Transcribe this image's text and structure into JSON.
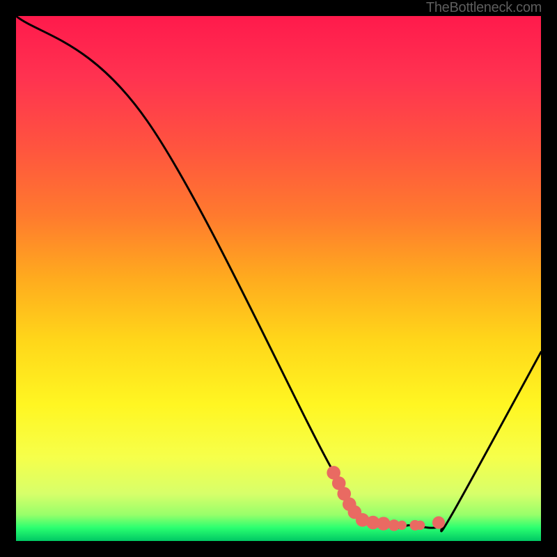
{
  "watermark": "TheBottleneck.com",
  "colors": {
    "frame_bg": "#000000",
    "watermark": "#5d5d5d",
    "curve_stroke": "#000000",
    "marker_fill": "#e96a62",
    "gradient_stops": [
      {
        "offset": 0.0,
        "color": "#ff1a4c"
      },
      {
        "offset": 0.12,
        "color": "#ff3350"
      },
      {
        "offset": 0.25,
        "color": "#ff543f"
      },
      {
        "offset": 0.38,
        "color": "#ff7a2e"
      },
      {
        "offset": 0.5,
        "color": "#ffab1e"
      },
      {
        "offset": 0.62,
        "color": "#ffd71a"
      },
      {
        "offset": 0.74,
        "color": "#fff622"
      },
      {
        "offset": 0.84,
        "color": "#f6ff4a"
      },
      {
        "offset": 0.91,
        "color": "#d7ff6a"
      },
      {
        "offset": 0.95,
        "color": "#98ff6a"
      },
      {
        "offset": 0.975,
        "color": "#2aff70"
      },
      {
        "offset": 1.0,
        "color": "#00c864"
      }
    ]
  },
  "chart_data": {
    "type": "line",
    "title": "",
    "xlabel": "",
    "ylabel": "",
    "xlim": [
      0,
      100
    ],
    "ylim": [
      0,
      100
    ],
    "grid": false,
    "series": [
      {
        "name": "bottleneck-curve",
        "x": [
          0,
          25,
          60,
          67,
          70,
          73,
          75,
          79,
          81,
          83,
          100
        ],
        "y": [
          100,
          80,
          14,
          4,
          3,
          2.5,
          3,
          2.5,
          3,
          5,
          36
        ]
      }
    ],
    "markers": [
      {
        "x": 60.5,
        "y": 13,
        "r": 1.3
      },
      {
        "x": 61.5,
        "y": 11,
        "r": 1.3
      },
      {
        "x": 62.5,
        "y": 9,
        "r": 1.3
      },
      {
        "x": 63.5,
        "y": 7,
        "r": 1.3
      },
      {
        "x": 64.5,
        "y": 5.5,
        "r": 1.3
      },
      {
        "x": 66.0,
        "y": 4.0,
        "r": 1.3
      },
      {
        "x": 68.0,
        "y": 3.5,
        "r": 1.3
      },
      {
        "x": 70.0,
        "y": 3.3,
        "r": 1.3
      },
      {
        "x": 72.0,
        "y": 3.0,
        "r": 1.1
      },
      {
        "x": 73.5,
        "y": 3.0,
        "r": 0.9
      },
      {
        "x": 76.0,
        "y": 3.0,
        "r": 1.0
      },
      {
        "x": 77.0,
        "y": 3.0,
        "r": 0.9
      },
      {
        "x": 80.5,
        "y": 3.5,
        "r": 1.2
      }
    ]
  }
}
